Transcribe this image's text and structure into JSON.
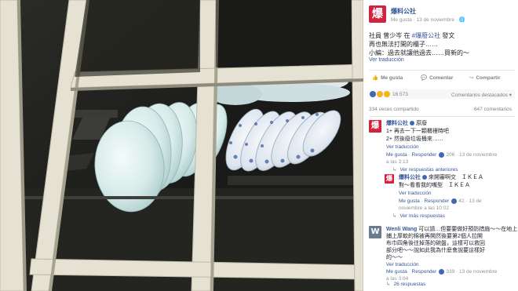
{
  "post": {
    "page_name": "爆料公社",
    "avatar_glyph": "爆",
    "meta": "Me gusta · 13 de noviembre · 🌐",
    "text_line1_prefix": "社員 曾少岑 在 ",
    "text_hashtag": "#爆廢公社",
    "text_line1_suffix": " 發文",
    "text_line2": "再也無法打開的櫃子……",
    "text_line3": "小編：過去就讓他過去……買新的～",
    "see_translation": "Ver traducción"
  },
  "actions": {
    "like": "Me gusta",
    "comment": "Comentar",
    "share": "Compartir",
    "like_icon": "thumbs-up-icon",
    "comment_icon": "speech-bubble-icon",
    "share_icon": "share-arrow-icon"
  },
  "stats": {
    "reaction_count": "16 573",
    "comment_sort": "Comentarios destacados ▾",
    "shares": "334 veces compartido",
    "comments": "647 comentarios"
  },
  "comments": [
    {
      "name": "爆料公社",
      "avatar": "爆",
      "text1": "原廢",
      "text2": "1+ 再去一下一顆櫃裡時吧",
      "text3": "2+ 然後廢垃圾桶來……",
      "translation": "Ver traducción",
      "like": "Me gusta",
      "reply": "Responder",
      "likes": "206",
      "date1": "13 de noviembre",
      "date2": "a las 3:13"
    },
    {
      "name": "爆料公社",
      "avatar": "爆",
      "text1": "來開審啊交　ＩＫＥＡ",
      "text2": "對～看看我的嘴型　ＩＫＥＡ",
      "translation": "Ver traducción",
      "like": "Me gusta",
      "reply": "Responder",
      "likes": "42",
      "date1": "13 de",
      "date2": "noviembre a las 10:02"
    },
    {
      "name": "Wenli Wang",
      "avatar": "W",
      "text1": "可以請…但要要做好預防措施～～在地上",
      "text2": "鋪上厚軟的棉被再開然後要第2個人拉開",
      "text3": "布巾四角後往掉落的碗盤，這樣可以救回",
      "text4": "部分吧～～說如此我為什麼會說要這樣好",
      "text5": "的～～",
      "translation": "Ver traducción",
      "like": "Me gusta",
      "reply": "Responder",
      "likes": "339",
      "date1": "13 de noviembre",
      "date2": "a las 3:04"
    }
  ],
  "links": {
    "prev_replies": "Ver respuestas anteriores",
    "more_replies": "Ver más respuestas",
    "replies_26": "26 respuestas"
  },
  "colors": {
    "brand_red": "#d2233e",
    "facebook_link": "#365899",
    "meta_gray": "#90949c"
  }
}
